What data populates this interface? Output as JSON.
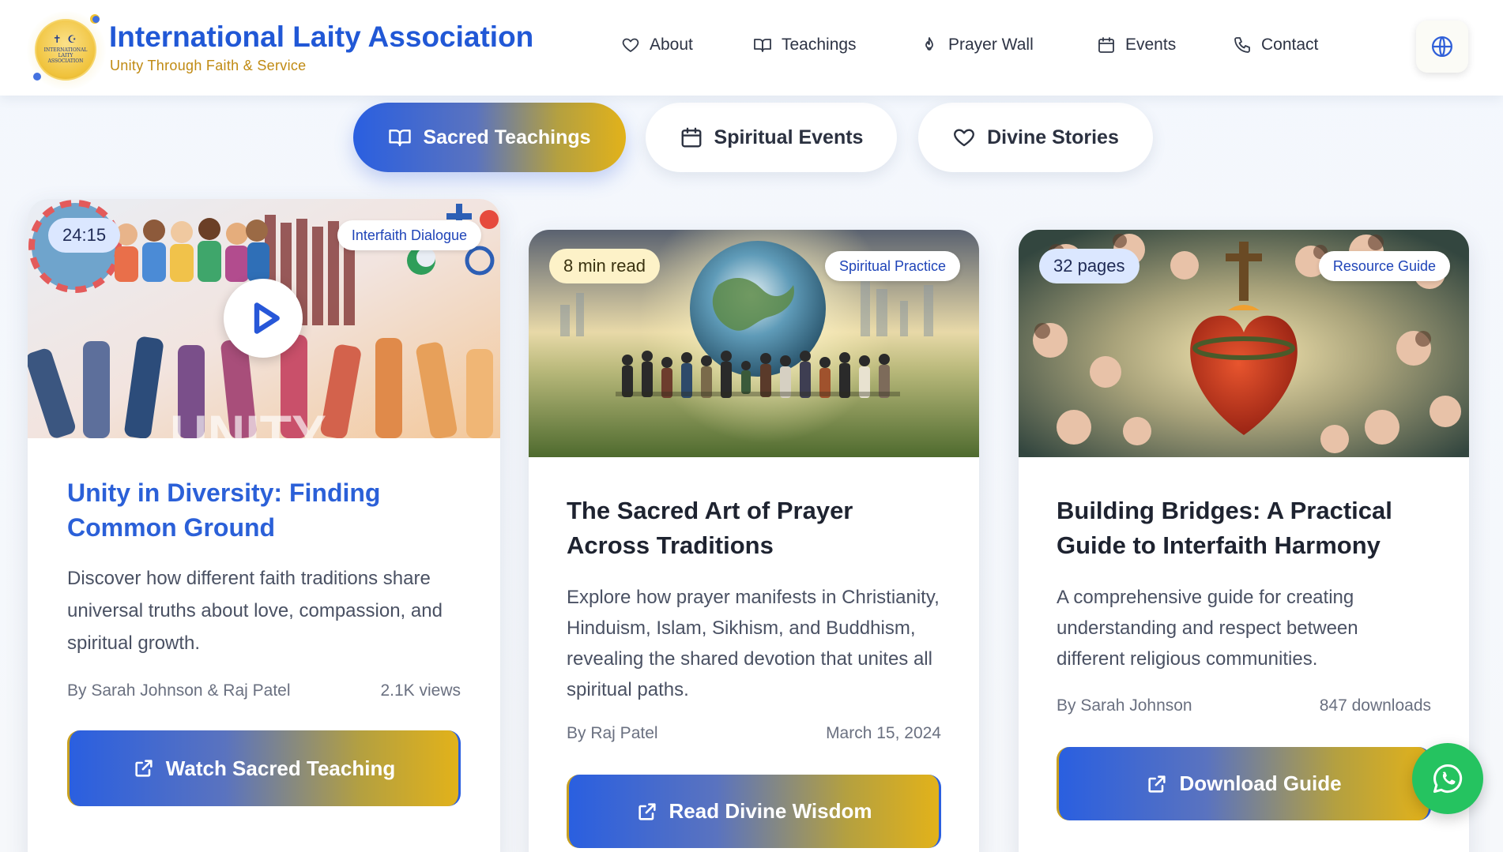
{
  "brand": {
    "title": "International Laity Association",
    "tagline": "Unity Through Faith & Service",
    "logo_text": "INTERNATIONAL LAITY ASSOCIATION",
    "logo_symbols": "✝ ☪"
  },
  "nav": {
    "items": [
      {
        "label": "About",
        "icon": "heart-icon"
      },
      {
        "label": "Teachings",
        "icon": "book-open-icon"
      },
      {
        "label": "Prayer Wall",
        "icon": "flame-icon"
      },
      {
        "label": "Events",
        "icon": "calendar-icon"
      },
      {
        "label": "Contact",
        "icon": "phone-icon"
      }
    ],
    "language_icon": "globe-icon"
  },
  "tabs": [
    {
      "label": "Sacred Teachings",
      "icon": "book-open-icon",
      "active": true
    },
    {
      "label": "Spiritual Events",
      "icon": "calendar-icon",
      "active": false
    },
    {
      "label": "Divine Stories",
      "icon": "heart-icon",
      "active": false
    }
  ],
  "cards": [
    {
      "badge": "24:15",
      "category": "Interfaith Dialogue",
      "title": "Unity in Diversity: Finding Common Ground",
      "description": "Discover how different faith traditions share universal truths about love, compassion, and spiritual growth.",
      "author": "By Sarah Johnson & Raj Patel",
      "stat": "2.1K views",
      "cta": "Watch Sacred Teaching",
      "image_text": "UNITY"
    },
    {
      "badge": "8 min read",
      "category": "Spiritual Practice",
      "title": "The Sacred Art of Prayer Across Traditions",
      "description": "Explore how prayer manifests in Christianity, Hinduism, Islam, Sikhism, and Buddhism, revealing the shared devotion that unites all spiritual paths.",
      "author": "By Raj Patel",
      "stat": "March 15, 2024",
      "cta": "Read Divine Wisdom"
    },
    {
      "badge": "32 pages",
      "category": "Resource Guide",
      "title": "Building Bridges: A Practical Guide to Interfaith Harmony",
      "description": "A comprehensive guide for creating understanding and respect between different religious communities.",
      "author": "By Sarah Johnson",
      "stat": "847 downloads",
      "cta": "Download Guide"
    }
  ],
  "colors": {
    "brand_blue": "#2158d6",
    "brand_gold": "#c08a12",
    "whatsapp_green": "#25c360"
  },
  "floating": {
    "whatsapp_icon": "whatsapp-icon"
  }
}
